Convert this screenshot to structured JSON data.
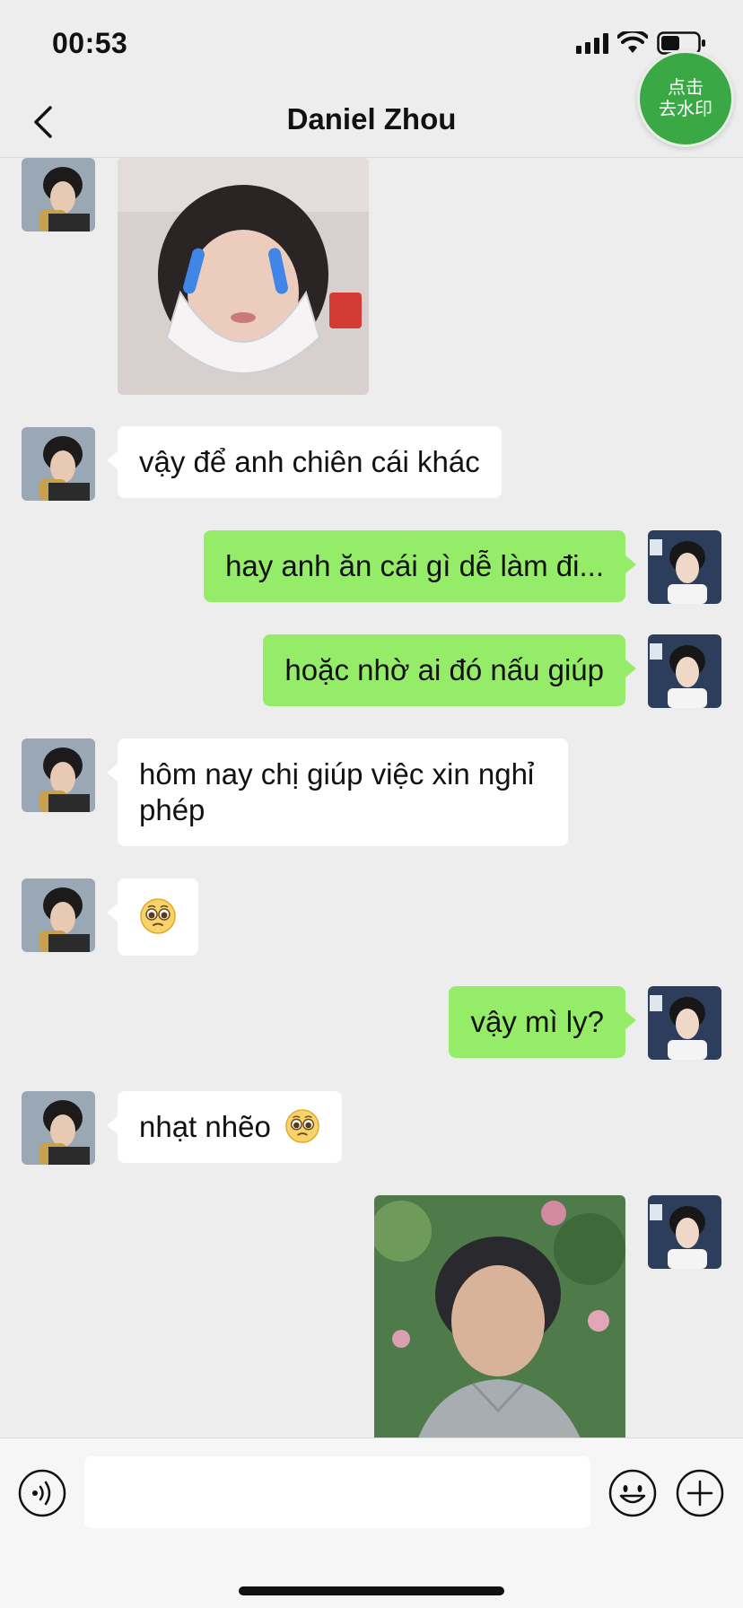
{
  "status_bar": {
    "time": "00:53"
  },
  "nav": {
    "title": "Daniel Zhou"
  },
  "watermark_badge": {
    "line1": "点击",
    "line2": "去水印"
  },
  "messages": [
    {
      "from": "contact",
      "type": "sticker"
    },
    {
      "from": "contact",
      "type": "text",
      "text": "vậy để anh chiên cái khác"
    },
    {
      "from": "me",
      "type": "text",
      "text": "hay anh ăn cái gì dễ làm đi..."
    },
    {
      "from": "me",
      "type": "text",
      "text": "hoặc nhờ ai đó nấu giúp"
    },
    {
      "from": "contact",
      "type": "text",
      "line1": "hôm nay chị giúp việc xin nghỉ",
      "line2": "phép"
    },
    {
      "from": "contact",
      "type": "emoji",
      "emoji": "pleading-face"
    },
    {
      "from": "me",
      "type": "text",
      "text": "vậy mì ly?"
    },
    {
      "from": "contact",
      "type": "text",
      "text": "nhạt nhẽo",
      "emoji": "pleading-face"
    },
    {
      "from": "me",
      "type": "photo"
    }
  ],
  "input_bar": {
    "placeholder": ""
  },
  "icons": {
    "back": "chevron-left-icon",
    "voice": "voice-icon",
    "emoji": "smiley-icon",
    "plus": "plus-icon"
  },
  "colors": {
    "background": "#ededed",
    "outgoing_bubble": "#95ec69",
    "incoming_bubble": "#ffffff",
    "badge": "#3aa845"
  }
}
